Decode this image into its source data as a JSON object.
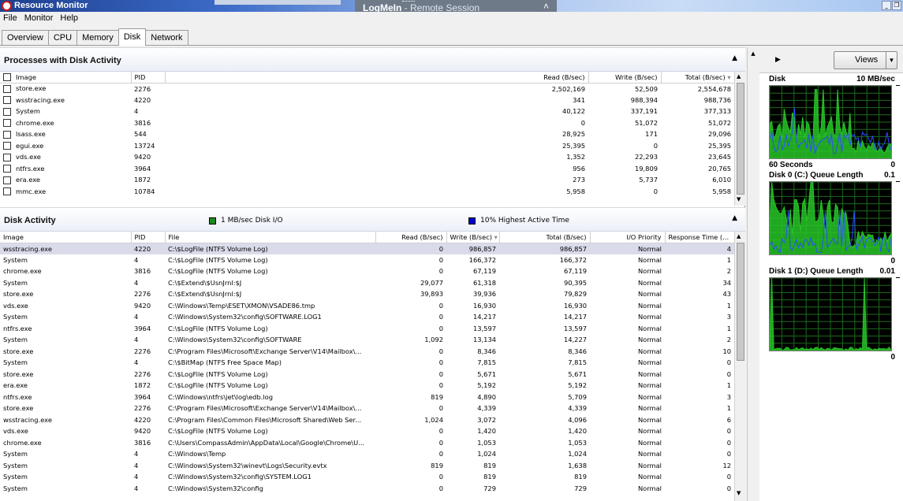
{
  "window": {
    "title": "Resource Monitor",
    "remote_session_brand": "LogMeIn",
    "remote_session_text": " - Remote Session"
  },
  "menu": [
    "File",
    "Monitor",
    "Help"
  ],
  "tabs": [
    {
      "label": "Overview",
      "active": false
    },
    {
      "label": "CPU",
      "active": false
    },
    {
      "label": "Memory",
      "active": false
    },
    {
      "label": "Disk",
      "active": true
    },
    {
      "label": "Network",
      "active": false
    }
  ],
  "processes": {
    "title": "Processes with Disk Activity",
    "columns": [
      "Image",
      "PID",
      "Read (B/sec)",
      "Write (B/sec)",
      "Total (B/sec)"
    ],
    "rows": [
      [
        "store.exe",
        "2276",
        "2,502,169",
        "52,509",
        "2,554,678"
      ],
      [
        "wsstracing.exe",
        "4220",
        "341",
        "988,394",
        "988,736"
      ],
      [
        "System",
        "4",
        "40,122",
        "337,191",
        "377,313"
      ],
      [
        "chrome.exe",
        "3816",
        "0",
        "51,072",
        "51,072"
      ],
      [
        "lsass.exe",
        "544",
        "28,925",
        "171",
        "29,096"
      ],
      [
        "egui.exe",
        "13724",
        "25,395",
        "0",
        "25,395"
      ],
      [
        "vds.exe",
        "9420",
        "1,352",
        "22,293",
        "23,645"
      ],
      [
        "ntfrs.exe",
        "3964",
        "956",
        "19,809",
        "20,765"
      ],
      [
        "era.exe",
        "1872",
        "273",
        "5,737",
        "6,010"
      ],
      [
        "mmc.exe",
        "10784",
        "5,958",
        "0",
        "5,958"
      ]
    ]
  },
  "disk_activity": {
    "title": "Disk Activity",
    "legend_io": "1 MB/sec Disk I/O",
    "legend_active": "10% Highest Active Time",
    "legend_io_color": "#1f8a1f",
    "legend_active_color": "#0000cc",
    "columns": [
      "Image",
      "PID",
      "File",
      "Read (B/sec)",
      "Write (B/sec)",
      "Total (B/sec)",
      "I/O Priority",
      "Response Time (..."
    ],
    "rows": [
      [
        "wsstracing.exe",
        "4220",
        "C:\\$LogFile (NTFS Volume Log)",
        "0",
        "986,857",
        "986,857",
        "Normal",
        "4"
      ],
      [
        "System",
        "4",
        "C:\\$LogFile (NTFS Volume Log)",
        "0",
        "166,372",
        "166,372",
        "Normal",
        "1"
      ],
      [
        "chrome.exe",
        "3816",
        "C:\\$LogFile (NTFS Volume Log)",
        "0",
        "67,119",
        "67,119",
        "Normal",
        "2"
      ],
      [
        "System",
        "4",
        "C:\\$Extend\\$UsnJrnl:$J",
        "29,077",
        "61,318",
        "90,395",
        "Normal",
        "34"
      ],
      [
        "store.exe",
        "2276",
        "C:\\$Extend\\$UsnJrnl:$J",
        "39,893",
        "39,936",
        "79,829",
        "Normal",
        "43"
      ],
      [
        "vds.exe",
        "9420",
        "C:\\Windows\\Temp\\ESET\\XMON\\VSADE86.tmp",
        "0",
        "16,930",
        "16,930",
        "Normal",
        "1"
      ],
      [
        "System",
        "4",
        "C:\\Windows\\System32\\config\\SOFTWARE.LOG1",
        "0",
        "14,217",
        "14,217",
        "Normal",
        "3"
      ],
      [
        "ntfrs.exe",
        "3964",
        "C:\\$LogFile (NTFS Volume Log)",
        "0",
        "13,597",
        "13,597",
        "Normal",
        "1"
      ],
      [
        "System",
        "4",
        "C:\\Windows\\System32\\config\\SOFTWARE",
        "1,092",
        "13,134",
        "14,227",
        "Normal",
        "2"
      ],
      [
        "store.exe",
        "2276",
        "C:\\Program Files\\Microsoft\\Exchange Server\\V14\\Mailbox\\...",
        "0",
        "8,346",
        "8,346",
        "Normal",
        "10"
      ],
      [
        "System",
        "4",
        "C:\\$BitMap (NTFS Free Space Map)",
        "0",
        "7,815",
        "7,815",
        "Normal",
        "0"
      ],
      [
        "store.exe",
        "2276",
        "C:\\$LogFile (NTFS Volume Log)",
        "0",
        "5,671",
        "5,671",
        "Normal",
        "0"
      ],
      [
        "era.exe",
        "1872",
        "C:\\$LogFile (NTFS Volume Log)",
        "0",
        "5,192",
        "5,192",
        "Normal",
        "1"
      ],
      [
        "ntfrs.exe",
        "3964",
        "C:\\Windows\\ntfrs\\jet\\log\\edb.log",
        "819",
        "4,890",
        "5,709",
        "Normal",
        "3"
      ],
      [
        "store.exe",
        "2276",
        "C:\\Program Files\\Microsoft\\Exchange Server\\V14\\Mailbox\\...",
        "0",
        "4,339",
        "4,339",
        "Normal",
        "1"
      ],
      [
        "wsstracing.exe",
        "4220",
        "C:\\Program Files\\Common Files\\Microsoft Shared\\Web Ser...",
        "1,024",
        "3,072",
        "4,096",
        "Normal",
        "6"
      ],
      [
        "vds.exe",
        "9420",
        "C:\\$LogFile (NTFS Volume Log)",
        "0",
        "1,420",
        "1,420",
        "Normal",
        "0"
      ],
      [
        "chrome.exe",
        "3816",
        "C:\\Users\\CompassAdmin\\AppData\\Local\\Google\\Chrome\\U...",
        "0",
        "1,053",
        "1,053",
        "Normal",
        "0"
      ],
      [
        "System",
        "4",
        "C:\\Windows\\Temp",
        "0",
        "1,024",
        "1,024",
        "Normal",
        "0"
      ],
      [
        "System",
        "4",
        "C:\\Windows\\System32\\winevt\\Logs\\Security.evtx",
        "819",
        "819",
        "1,638",
        "Normal",
        "12"
      ],
      [
        "System",
        "4",
        "C:\\Windows\\System32\\config\\SYSTEM.LOG1",
        "0",
        "819",
        "819",
        "Normal",
        "0"
      ],
      [
        "System",
        "4",
        "C:\\Windows\\System32\\config",
        "0",
        "729",
        "729",
        "Normal",
        "0"
      ]
    ]
  },
  "right_pane": {
    "views_label": "Views",
    "graphs": [
      {
        "label": "Disk",
        "scale": "10 MB/sec",
        "footer_left": "60 Seconds",
        "footer_right": "0"
      },
      {
        "label": "Disk 0 (C:) Queue Length",
        "scale": "0.1",
        "footer_left": "",
        "footer_right": "0"
      },
      {
        "label": "Disk 1 (D:) Queue Length",
        "scale": "0.01",
        "footer_left": "",
        "footer_right": "0"
      }
    ]
  }
}
